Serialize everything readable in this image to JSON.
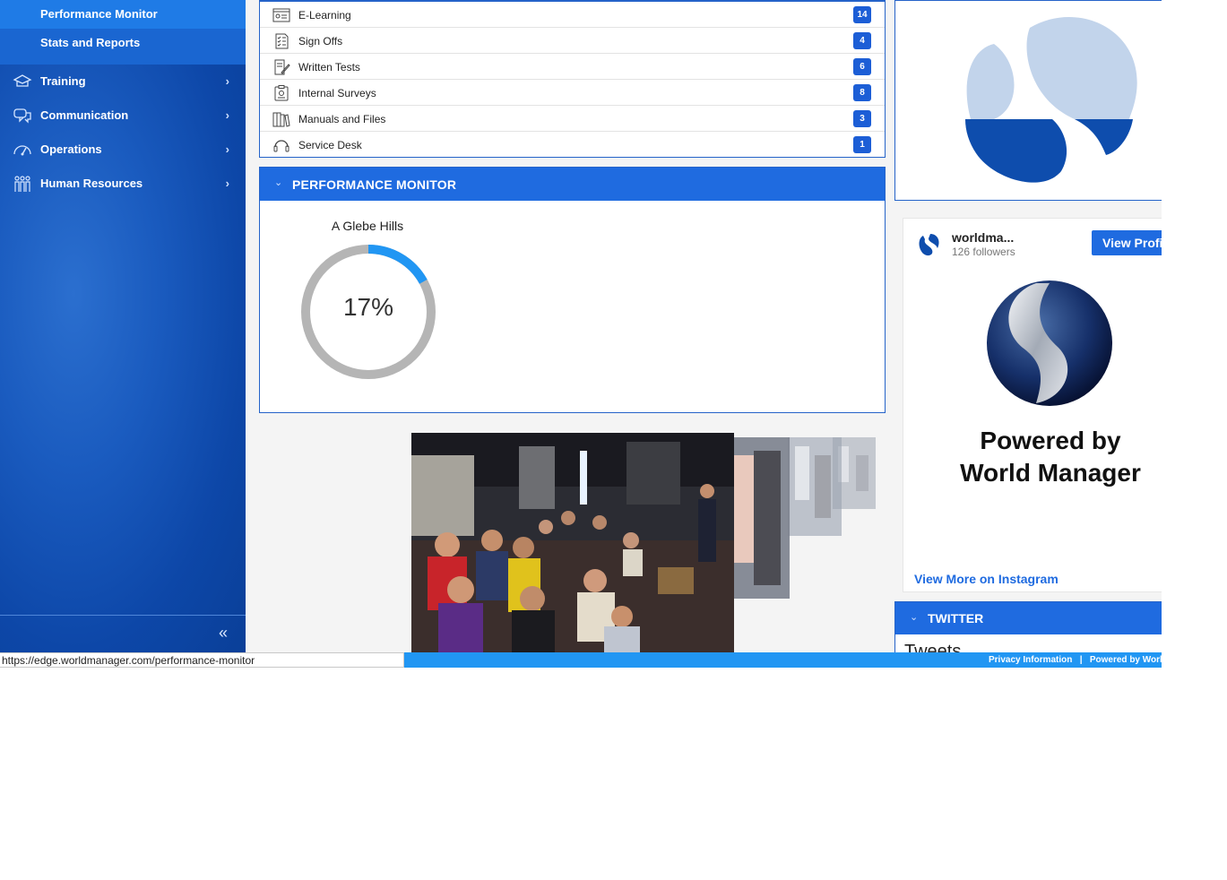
{
  "sidebar": {
    "sub_items": [
      {
        "label": "Performance Monitor"
      },
      {
        "label": "Stats and Reports"
      }
    ],
    "nav_items": [
      {
        "label": "Training",
        "icon": "training-icon"
      },
      {
        "label": "Communication",
        "icon": "communication-icon"
      },
      {
        "label": "Operations",
        "icon": "operations-icon"
      },
      {
        "label": "Human Resources",
        "icon": "human-resources-icon"
      }
    ],
    "collapse_glyph": "«",
    "chevron_glyph": "›"
  },
  "documents": [
    {
      "label": "E-Learning",
      "count": "14",
      "icon": "elearning-icon"
    },
    {
      "label": "Sign Offs",
      "count": "4",
      "icon": "checklist-icon"
    },
    {
      "label": "Written Tests",
      "count": "6",
      "icon": "written-test-icon"
    },
    {
      "label": "Internal Surveys",
      "count": "8",
      "icon": "survey-icon"
    },
    {
      "label": "Manuals and Files",
      "count": "3",
      "icon": "manuals-icon"
    },
    {
      "label": "Service Desk",
      "count": "1",
      "icon": "headset-icon"
    }
  ],
  "performance": {
    "title": "PERFORMANCE MONITOR",
    "location": "A Glebe Hills",
    "percent_label": "17%",
    "percent_value": 17
  },
  "instagram": {
    "name": "worldma...",
    "followers": "126 followers",
    "view_profile": "View Profile",
    "caption_line1": "Powered by",
    "caption_line2": "World Manager",
    "view_more": "View More on Instagram"
  },
  "twitter": {
    "title": "TWITTER",
    "tweets": "Tweets"
  },
  "footer": {
    "privacy": "Privacy Information",
    "separator": "|",
    "powered": "Powered by World Manager"
  },
  "status_url": "https://edge.worldmanager.com/performance-monitor",
  "colors": {
    "brand_blue": "#1f6be0",
    "sidebar_blue": "#0d47a8",
    "gauge_progress": "#2196f3",
    "gauge_track": "#b5b5b5",
    "footer_blue": "#2196f3"
  }
}
